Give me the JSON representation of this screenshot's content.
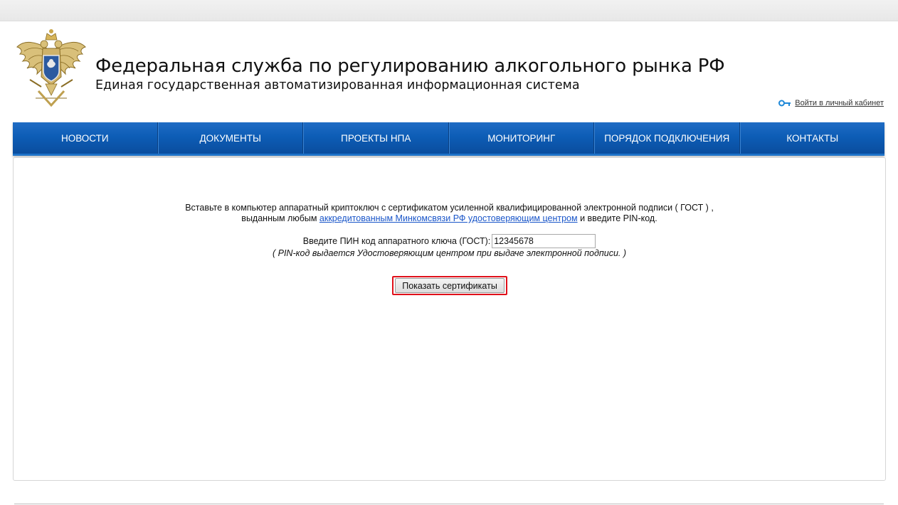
{
  "header": {
    "title": "Федеральная служба по регулированию алкогольного рынка РФ",
    "subtitle": "Единая государственная автоматизированная информационная система",
    "emblem_icon": "double-headed-eagle-emblem",
    "login_icon": "key-icon",
    "login_link": "Войти в личный кабинет"
  },
  "nav": {
    "items": [
      {
        "label": "НОВОСТИ"
      },
      {
        "label": "ДОКУМЕНТЫ"
      },
      {
        "label": "ПРОЕКТЫ НПА"
      },
      {
        "label": "МОНИТОРИНГ"
      },
      {
        "label": "ПОРЯДОК ПОДКЛЮЧЕНИЯ"
      },
      {
        "label": "КОНТАКТЫ"
      }
    ]
  },
  "main": {
    "instruction_line1": "Вставьте в компьютер аппаратный криптоключ с сертификатом усиленной квалифицированной электронной подписи ( ГОСТ ) ,",
    "instruction_line2_pre": "выданным любым ",
    "instruction_link": "аккредитованным Минкомсвязи РФ удостоверяющим центром",
    "instruction_line2_post": " и введите PIN-код.",
    "pin_label": "Введите ПИН код аппаратного ключа (ГОСТ):",
    "pin_value": "12345678",
    "pin_hint": "( PIN-код выдается Удостоверяющим центром при выдаче электронной подписи. )",
    "show_certs_button": "Показать сертификаты"
  },
  "colors": {
    "nav_blue": "#0d5db6",
    "highlight_red": "#e0101a",
    "link_blue": "#1a56c9"
  }
}
